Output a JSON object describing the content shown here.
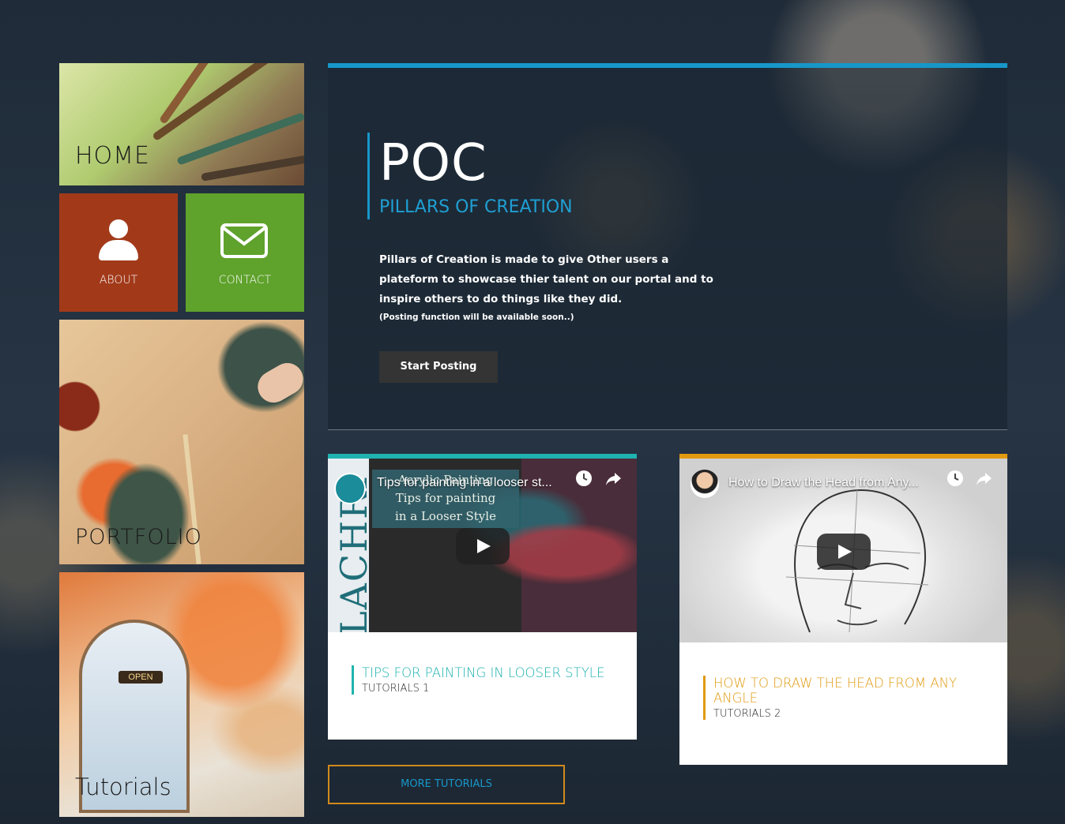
{
  "nav": {
    "home_label": "HOME",
    "about_label": "ABOUT",
    "contact_label": "CONTACT",
    "portfolio_label": "PORTFOLIO",
    "tutorials_label": "Tutorials",
    "door_sign": "OPEN"
  },
  "hero": {
    "title": "POC",
    "subtitle": "PILLARS OF CREATION",
    "description": "Pillars of Creation is made to give Other users a plateform to showcase thier talent on our portal and to inspire others to do things like they did.",
    "note": "(Posting function will be available soon..)",
    "cta_label": "Start Posting"
  },
  "cards": [
    {
      "video_title": "Tips for painting in a looser st...",
      "overlay_text_1": "Acrylic Painting",
      "overlay_text_2": "Tips for painting",
      "overlay_text_3": "in a Looser Style",
      "side_text": "LACHRI",
      "title": "TIPS FOR PAINTING IN LOOSER STYLE",
      "subtitle": "TUTORIALS 1",
      "accent": "#1fb2b0"
    },
    {
      "video_title": "How to Draw the Head from Any...",
      "title": "HOW TO DRAW THE HEAD FROM ANY ANGLE",
      "subtitle": "TUTORIALS 2",
      "accent": "#e09a10"
    }
  ],
  "more_tutorials_label": "MORE TUTORIALS",
  "colors": {
    "hero_accent": "#1797c9",
    "about_tile": "#a23a1a",
    "contact_tile": "#5fa22c"
  }
}
